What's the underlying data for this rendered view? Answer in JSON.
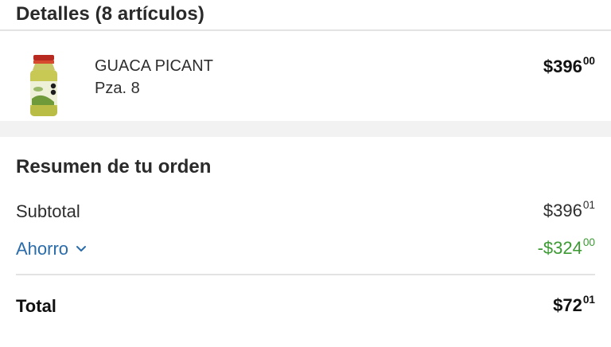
{
  "colors": {
    "link_blue": "#2a6cab",
    "savings_green": "#3c9a33",
    "divider": "#e3e3e3",
    "band": "#f2f2f2"
  },
  "details": {
    "title": "Detalles (8 artículos)"
  },
  "item": {
    "name": "GUACA PICANT",
    "quantity": "Pza. 8",
    "price": {
      "main": "$396",
      "cents": "00"
    },
    "image_icon": "salsa-jar-icon"
  },
  "summary": {
    "title": "Resumen de tu orden",
    "subtotal": {
      "label": "Subtotal",
      "main": "$396",
      "cents": "01"
    },
    "savings": {
      "label": "Ahorro",
      "main": "-$324",
      "cents": "00",
      "icon": "chevron-down-icon"
    },
    "total": {
      "label": "Total",
      "main": "$72",
      "cents": "01"
    }
  }
}
